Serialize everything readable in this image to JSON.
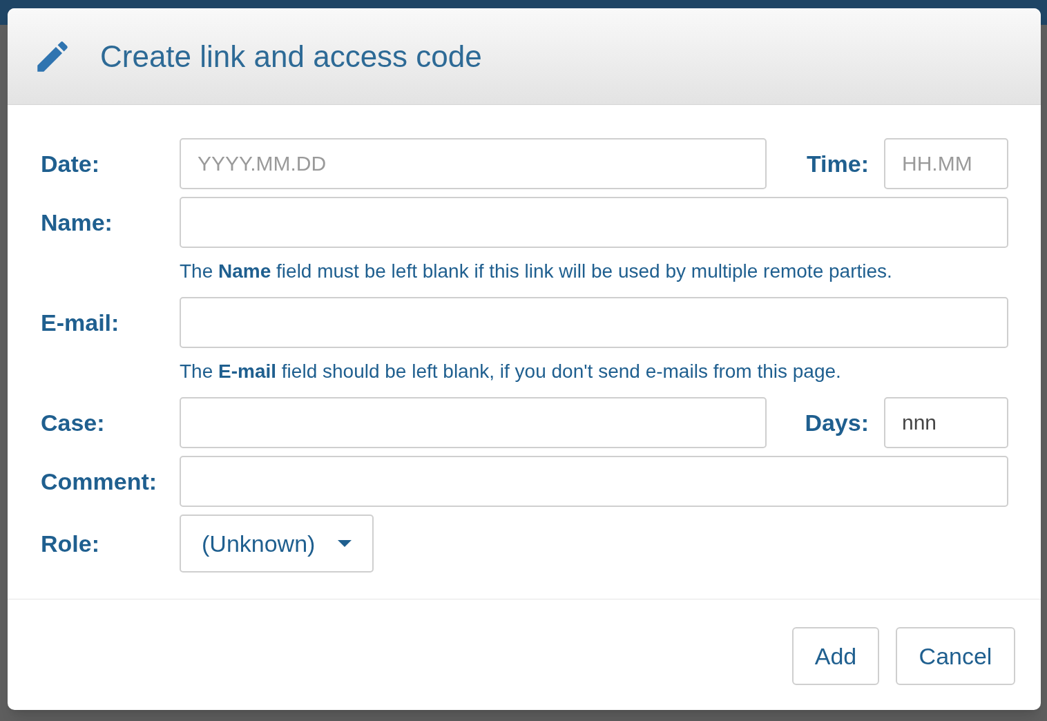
{
  "dialog": {
    "title": "Create link and access code"
  },
  "fields": [
    {
      "kind": "pair",
      "label": "Date:",
      "placeholder": "YYYY.MM.DD",
      "label2": "Time:",
      "placeholder2": "HH.MM"
    },
    {
      "kind": "text",
      "label": "Name:",
      "help": "The **Name** field must be left blank if this link will be used by multiple remote parties."
    },
    {
      "kind": "text",
      "label": "E-mail:",
      "help": "The **E-mail** field should be left blank, if you don't send e-mails from this page."
    },
    {
      "kind": "pair",
      "label": "Case:",
      "label2": "Days:",
      "value2": "nnn"
    },
    {
      "kind": "text",
      "label": "Comment:"
    },
    {
      "kind": "select",
      "label": "Role:",
      "value": "(Unknown)"
    }
  ],
  "buttons": [
    "Add",
    "Cancel"
  ]
}
